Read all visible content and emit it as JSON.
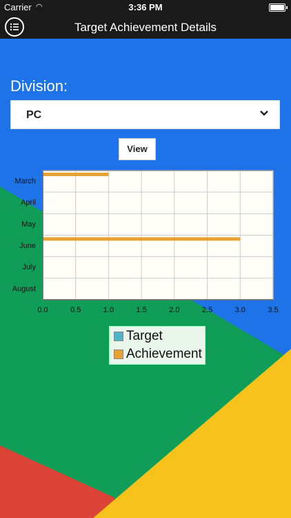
{
  "status": {
    "carrier": "Carrier",
    "time": "3:36 PM"
  },
  "nav": {
    "title": "Target Achievement Details"
  },
  "form": {
    "division_label": "Division:",
    "division_value": "PC",
    "view_label": "View"
  },
  "colors": {
    "target": "#4fb3c9",
    "achievement": "#e8a233",
    "plot_bg": "#fffdf7"
  },
  "chart_data": {
    "type": "bar",
    "orientation": "horizontal",
    "categories": [
      "March",
      "April",
      "May",
      "June",
      "July",
      "August"
    ],
    "series": [
      {
        "name": "Target",
        "values": [
          0,
          0,
          0,
          0,
          0,
          0
        ]
      },
      {
        "name": "Achievement",
        "values": [
          1,
          0,
          0,
          3,
          0,
          0
        ]
      }
    ],
    "xlim": [
      0,
      3.5
    ],
    "xticks": [
      "0.0",
      "0.5",
      "1.0",
      "1.5",
      "2.0",
      "2.5",
      "3.0",
      "3.5"
    ],
    "grid": true,
    "legend": "bottom"
  }
}
